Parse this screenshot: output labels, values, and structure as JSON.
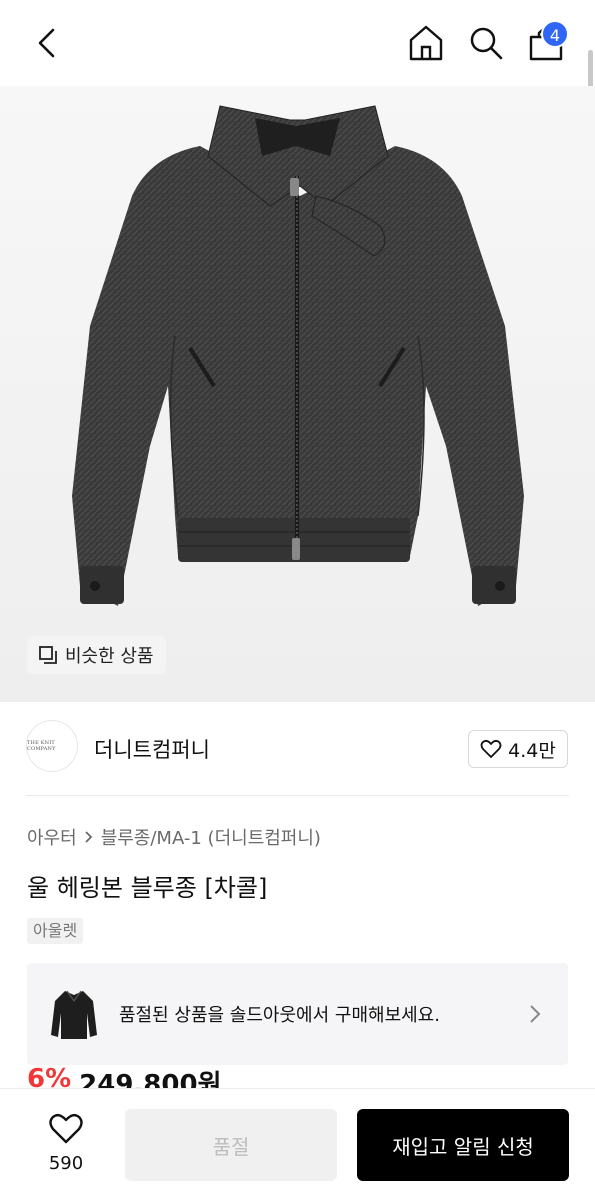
{
  "header": {
    "back_icon": "chevron-left-icon",
    "home_icon": "home-icon",
    "search_icon": "search-icon",
    "cart_icon": "shopping-bag-icon",
    "cart_badge": "4",
    "badge_color": "#2f66f5"
  },
  "hero": {
    "image": "charcoal wool herringbone zip-up blouson jacket",
    "similar_button_label": "비슷한 상품",
    "similar_icon": "similar-items-icon"
  },
  "seller": {
    "logo_text": "THE KNIT COMPANY",
    "name": "더니트컴퍼니",
    "like_icon": "heart-outline-icon",
    "like_count": "4.4만"
  },
  "breadcrumb": {
    "category": "아우터",
    "separator_icon": "chevron-right-icon",
    "subcategory": "블루종/MA-1 (더니트컴퍼니)"
  },
  "product": {
    "title": "울 헤링본 블루종 [차콜]",
    "tag": "아울렛",
    "discount": "6%",
    "price": "249,800원",
    "discount_color": "#f0383a"
  },
  "promo": {
    "text": "품절된 상품을 솔드아웃에서 구매해보세요.",
    "thumb": "black jacket thumbnail",
    "chevron_icon": "chevron-right-icon"
  },
  "bottom": {
    "wish_icon": "heart-outline-icon",
    "wish_count": "590",
    "soldout_label": "품절",
    "restock_label": "재입고 알림 신청"
  }
}
